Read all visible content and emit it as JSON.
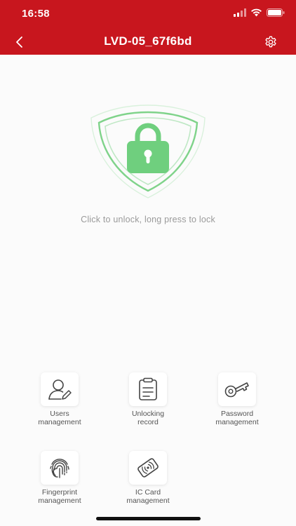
{
  "status_bar": {
    "time": "16:58"
  },
  "nav": {
    "title": "LVD-05_67f6bd"
  },
  "lock": {
    "hint": "Click to unlock, long press to lock"
  },
  "menu": [
    {
      "label": "Users\nmanagement",
      "icon": "user-edit-icon"
    },
    {
      "label": "Unlocking\nrecord",
      "icon": "clipboard-icon"
    },
    {
      "label": "Password\nmanagement",
      "icon": "key-icon"
    },
    {
      "label": "Fingerprint\nmanagement",
      "icon": "fingerprint-icon"
    },
    {
      "label": "IC Card\nmanagement",
      "icon": "ic-card-icon"
    }
  ],
  "colors": {
    "brand": "#c8161e",
    "lock_green": "#6fcf7e",
    "shield_outline": "#7fd38a"
  }
}
